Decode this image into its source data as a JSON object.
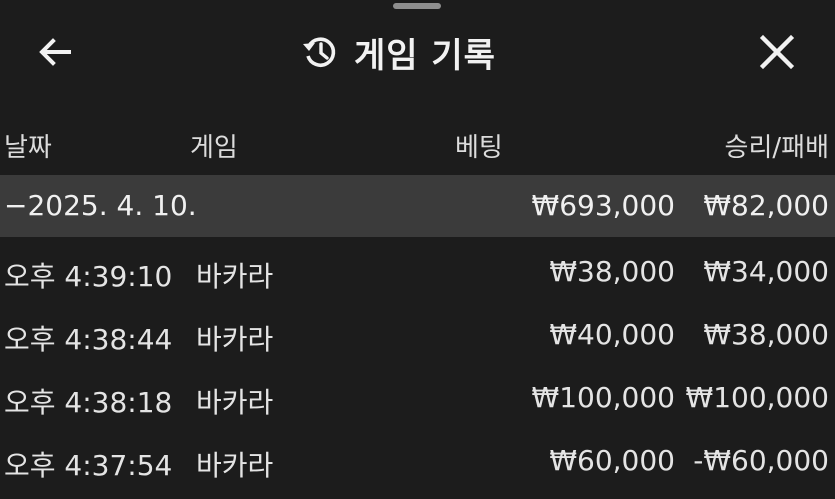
{
  "header": {
    "title": "게임 기록",
    "back_icon": "arrow-left-icon",
    "history_icon": "history-icon",
    "close_icon": "close-icon"
  },
  "columns": {
    "date": "날짜",
    "game": "게임",
    "bet": "베팅",
    "result": "승리/패배"
  },
  "date_group": {
    "date": "−2025. 4. 10.",
    "bet_total": "₩693,000",
    "result_total": "₩82,000"
  },
  "records": [
    {
      "time": "오후 4:39:10",
      "game": "바카라",
      "bet": "₩38,000",
      "result": "₩34,000"
    },
    {
      "time": "오후 4:38:44",
      "game": "바카라",
      "bet": "₩40,000",
      "result": "₩38,000"
    },
    {
      "time": "오후 4:38:18",
      "game": "바카라",
      "bet": "₩100,000",
      "result": "₩100,000"
    },
    {
      "time": "오후 4:37:54",
      "game": "바카라",
      "bet": "₩60,000",
      "result": "-₩60,000"
    }
  ]
}
